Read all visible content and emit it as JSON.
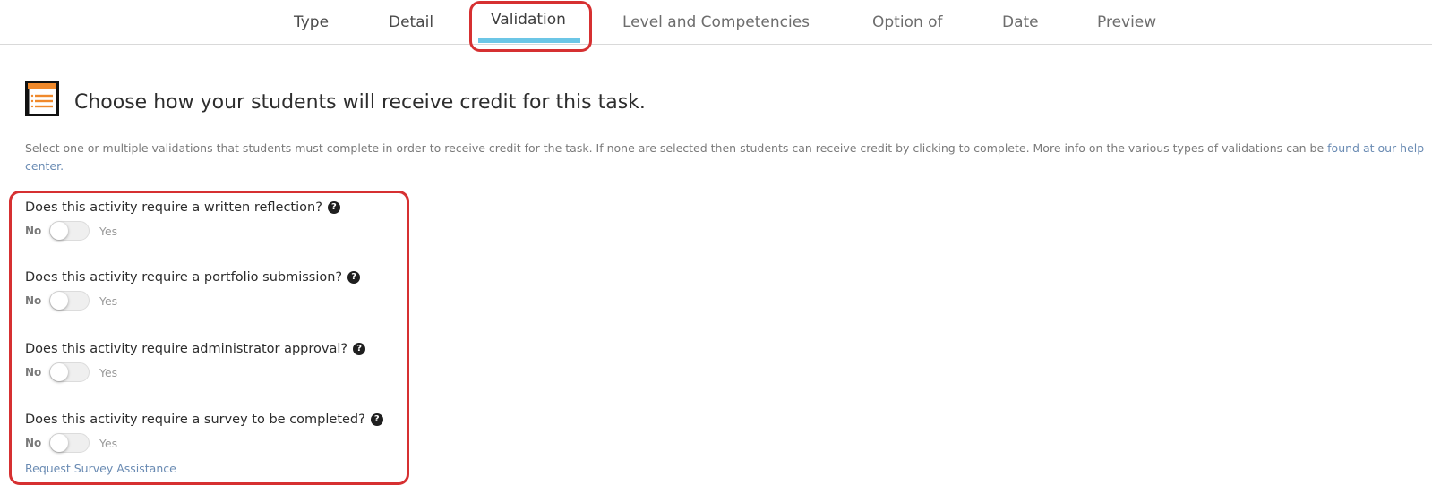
{
  "tabs": [
    {
      "label": "Type",
      "state": "default"
    },
    {
      "label": "Detail",
      "state": "default"
    },
    {
      "label": "Validation",
      "state": "active"
    },
    {
      "label": "Level and Competencies",
      "state": "default"
    },
    {
      "label": "Option of",
      "state": "default"
    },
    {
      "label": "Date",
      "state": "default"
    },
    {
      "label": "Preview",
      "state": "default"
    }
  ],
  "header": {
    "icon": "list-document-icon",
    "title": "Choose how your students will receive credit for this task."
  },
  "description": {
    "text": "Select one or multiple validations that students must complete in order to receive credit for the task. If none are selected then students can receive credit by clicking to complete. More info on the various types of validations can be ",
    "link_text": "found at our help center."
  },
  "questions": [
    {
      "label": "Does this activity require a written reflection?",
      "help_icon": "question-circle-icon",
      "off_label": "No",
      "on_label": "Yes",
      "value": false
    },
    {
      "label": "Does this activity require a portfolio submission?",
      "help_icon": "question-circle-icon",
      "off_label": "No",
      "on_label": "Yes",
      "value": false
    },
    {
      "label": "Does this activity require administrator approval?",
      "help_icon": "question-circle-icon",
      "off_label": "No",
      "on_label": "Yes",
      "value": false
    },
    {
      "label": "Does this activity require a survey to be completed?",
      "help_icon": "question-circle-icon",
      "off_label": "No",
      "on_label": "Yes",
      "value": false
    }
  ],
  "survey_assistance_link": "Request Survey Assistance",
  "colors": {
    "active_tab_underline": "#6cc6e6",
    "annotation_border": "#d63031",
    "link": "#6a8bb3",
    "icon_accent": "#f0892b"
  }
}
